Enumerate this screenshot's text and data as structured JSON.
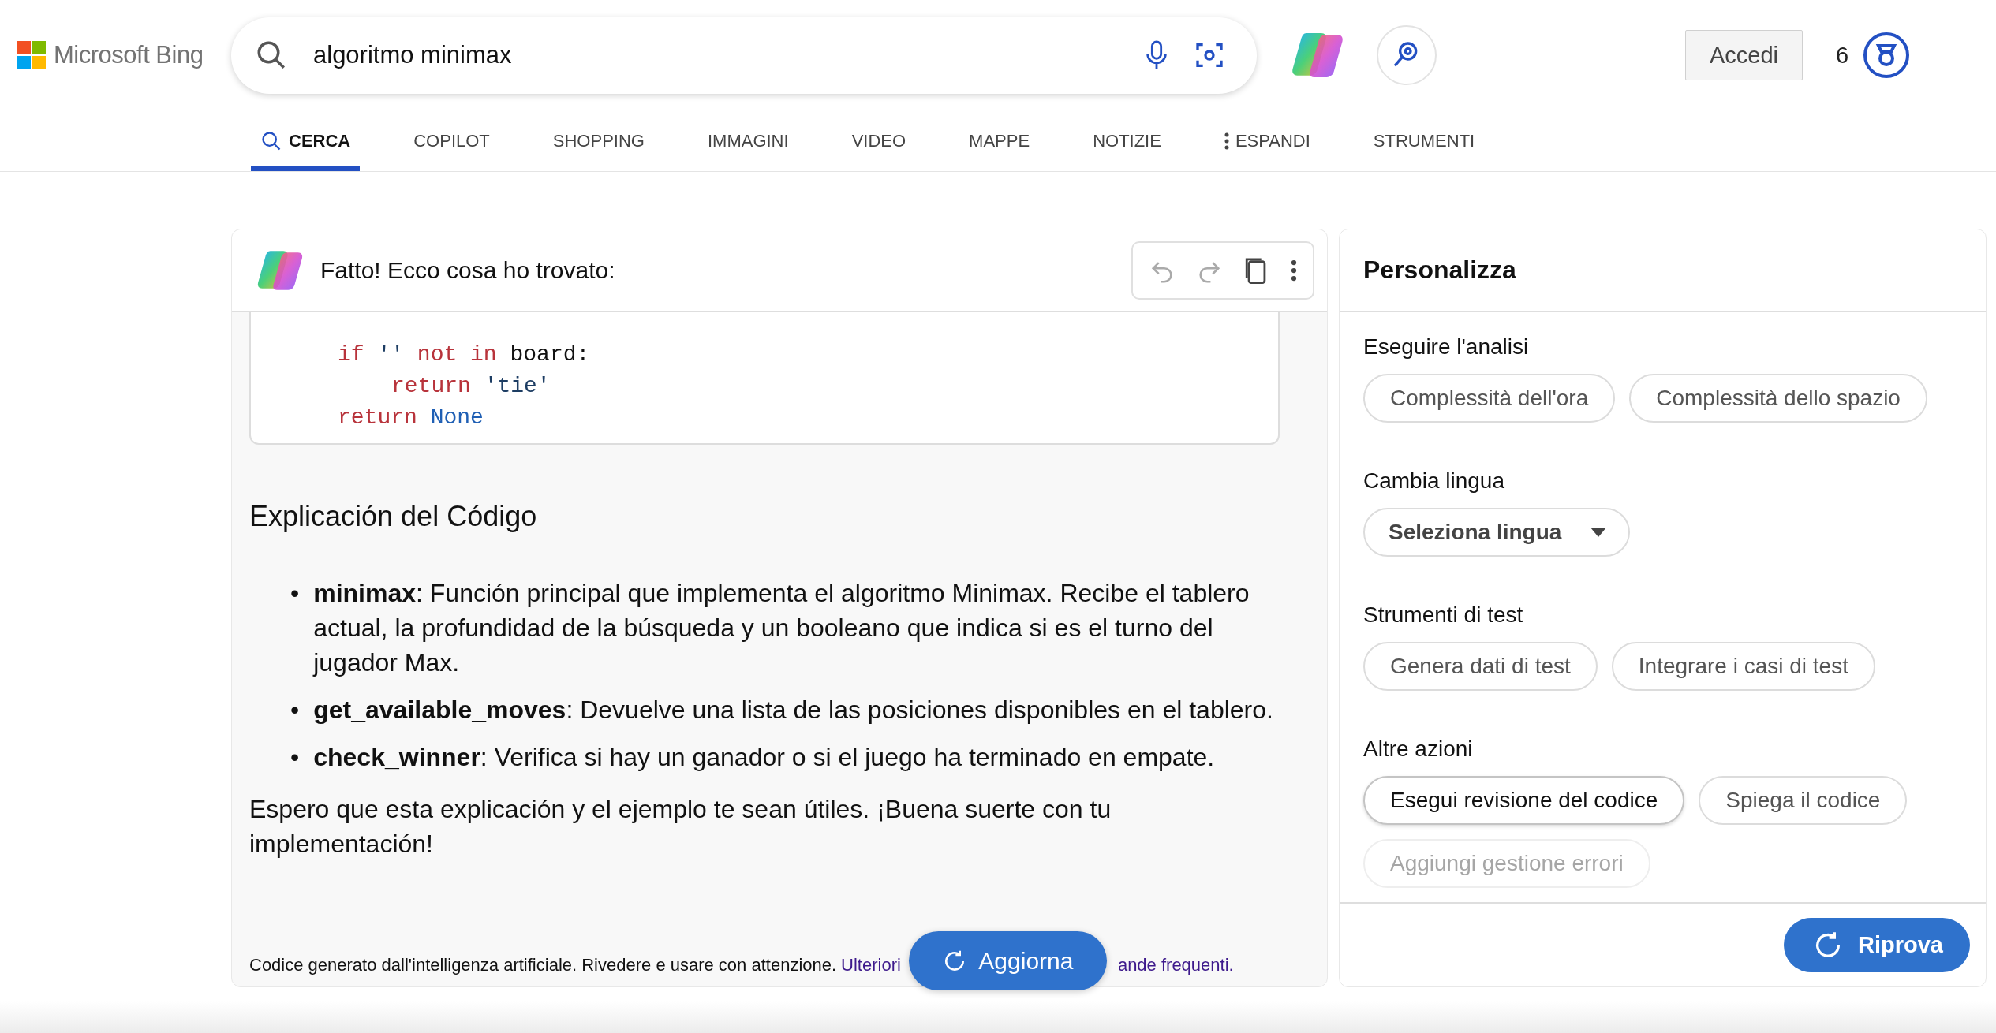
{
  "header": {
    "logo": "Microsoft Bing",
    "search": {
      "value": "algoritmo minimax"
    },
    "sign_in": "Accedi",
    "rewards_count": "6"
  },
  "tabs": [
    {
      "label": "CERCA",
      "selected": true,
      "kind": "search"
    },
    {
      "label": "COPILOT",
      "selected": false,
      "kind": "plain"
    },
    {
      "label": "SHOPPING",
      "selected": false,
      "kind": "plain"
    },
    {
      "label": "IMMAGINI",
      "selected": false,
      "kind": "plain"
    },
    {
      "label": "VIDEO",
      "selected": false,
      "kind": "plain"
    },
    {
      "label": "MAPPE",
      "selected": false,
      "kind": "plain"
    },
    {
      "label": "NOTIZIE",
      "selected": false,
      "kind": "plain"
    },
    {
      "label": "ESPANDI",
      "selected": false,
      "kind": "more"
    },
    {
      "label": "STRUMENTI",
      "selected": false,
      "kind": "plain"
    }
  ],
  "answer": {
    "title": "Fatto! Ecco cosa ho trovato:",
    "code_lines": [
      {
        "tokens": [
          {
            "kind": "keyword",
            "text": "if "
          },
          {
            "kind": "string",
            "text": "'' "
          },
          {
            "kind": "keyword",
            "text": "not in "
          },
          {
            "kind": "plain",
            "text": "board:"
          }
        ],
        "children": [
          {
            "tokens": [
              {
                "kind": "keyword",
                "text": "return "
              },
              {
                "kind": "string",
                "text": "'tie'"
              }
            ]
          }
        ]
      },
      {
        "tokens": [
          {
            "kind": "keyword",
            "text": "return "
          },
          {
            "kind": "constant",
            "text": "None"
          }
        ]
      }
    ],
    "heading": "Explicación del Código",
    "bullets": [
      {
        "marker": "•",
        "text": "**minimax**: Función principal que implementa el algoritmo Minimax. Recibe el tablero actual, la profundidad de la búsqueda y un booleano que indica si es el turno del jugador Max."
      },
      {
        "marker": "•",
        "text": "**get_available_moves**: Devuelve una lista de las posiciones disponibles en el tablero."
      },
      {
        "marker": "•",
        "text": "**check_winner**: Verifica si hay un ganador o si el juego ha terminado en empate."
      }
    ],
    "closing": "Espero que esta explicación y el ejemplo te sean útiles. ¡Buena suerte con tu implementación!",
    "disclaimer": "Codice generato dall'intelligenza artificiale. Rivedere e usare con attenzione.",
    "link_start": "Ulteriori",
    "link_end": "ande frequenti.",
    "refresh_button": "Aggiorna"
  },
  "panel": {
    "title": "Personalizza",
    "sections": [
      {
        "label": "Eseguire l'analisi",
        "kind": "chips",
        "chips": [
          {
            "label": "Complessità dell'ora",
            "focused": false,
            "disabled": false
          },
          {
            "label": "Complessità dello spazio",
            "focused": false,
            "disabled": false
          }
        ]
      },
      {
        "label": "Cambia lingua",
        "kind": "select",
        "value": "Seleziona lingua"
      },
      {
        "label": "Strumenti di test",
        "kind": "chips",
        "chips": [
          {
            "label": "Genera dati di test",
            "focused": false,
            "disabled": false
          },
          {
            "label": "Integrare i casi di test",
            "focused": false,
            "disabled": false
          }
        ]
      },
      {
        "label": "Altre azioni",
        "kind": "chips",
        "chips": [
          {
            "label": "Esegui revisione del codice",
            "focused": true,
            "disabled": false
          },
          {
            "label": "Spiega il codice",
            "focused": false,
            "disabled": false
          },
          {
            "label": "Aggiungi gestione errori",
            "focused": false,
            "disabled": true
          }
        ]
      }
    ],
    "retry_button": "Riprova"
  }
}
